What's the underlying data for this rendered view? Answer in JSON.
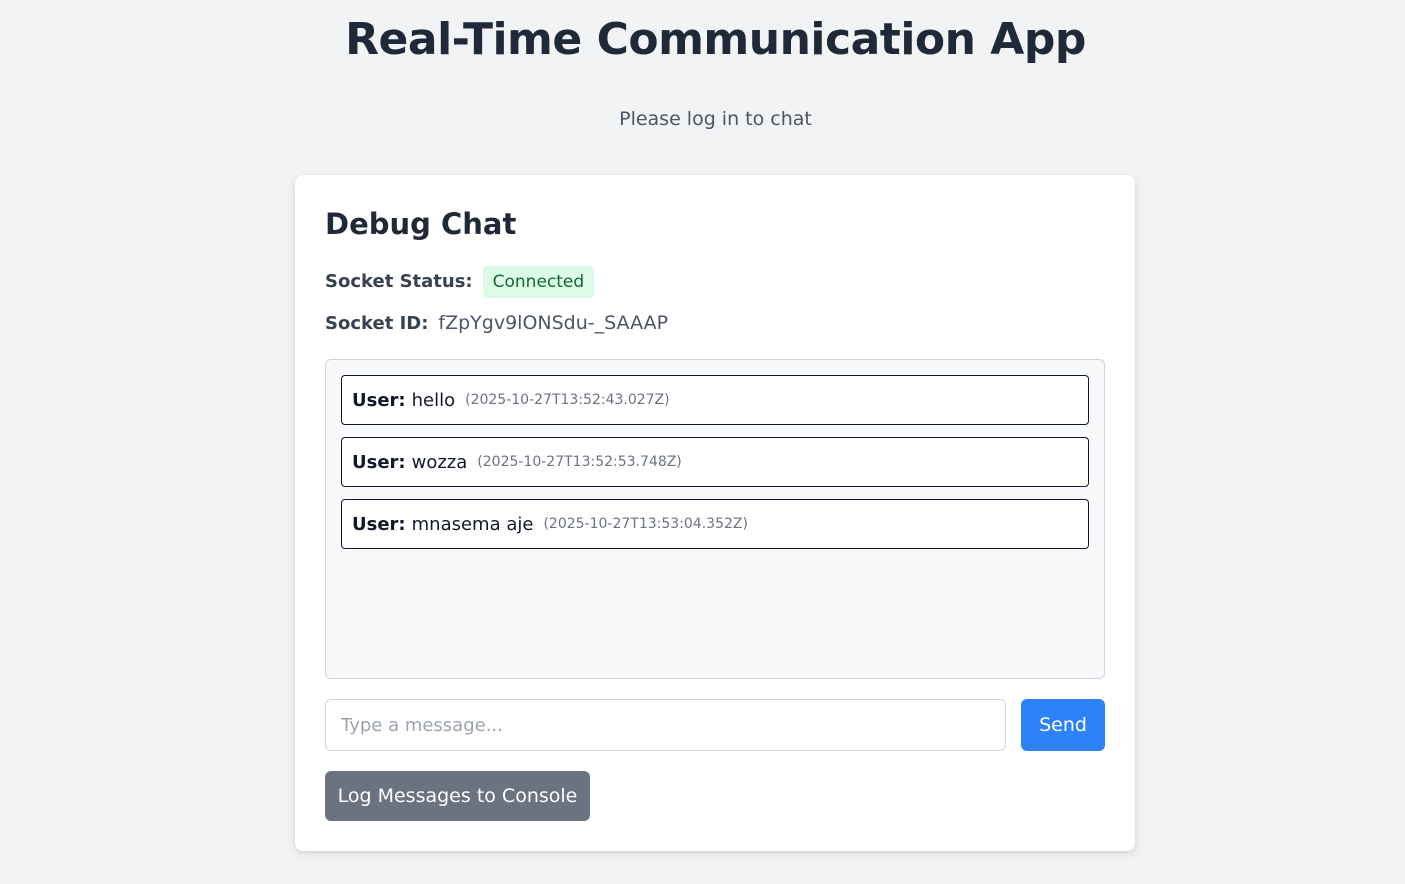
{
  "app": {
    "title": "Real-Time Communication App",
    "login_message": "Please log in to chat"
  },
  "debug_chat": {
    "title": "Debug Chat",
    "status_label": "Socket Status:",
    "status_value": "Connected",
    "id_label": "Socket ID:",
    "id_value": "fZpYgv9lONSdu-_SAAAP",
    "messages": [
      {
        "user": "User:",
        "text": "hello",
        "timestamp": "(2025-10-27T13:52:43.027Z)"
      },
      {
        "user": "User:",
        "text": "wozza",
        "timestamp": "(2025-10-27T13:52:53.748Z)"
      },
      {
        "user": "User:",
        "text": "mnasema aje",
        "timestamp": "(2025-10-27T13:53:04.352Z)"
      }
    ],
    "input_placeholder": "Type a message...",
    "input_value": "",
    "send_label": "Send",
    "log_label": "Log Messages to Console"
  },
  "colors": {
    "page_background": "#f2f3f5",
    "send_button": "#2d82f7",
    "log_button": "#6b7280",
    "status_badge_bg": "#dcfce7",
    "status_badge_text": "#166534"
  }
}
